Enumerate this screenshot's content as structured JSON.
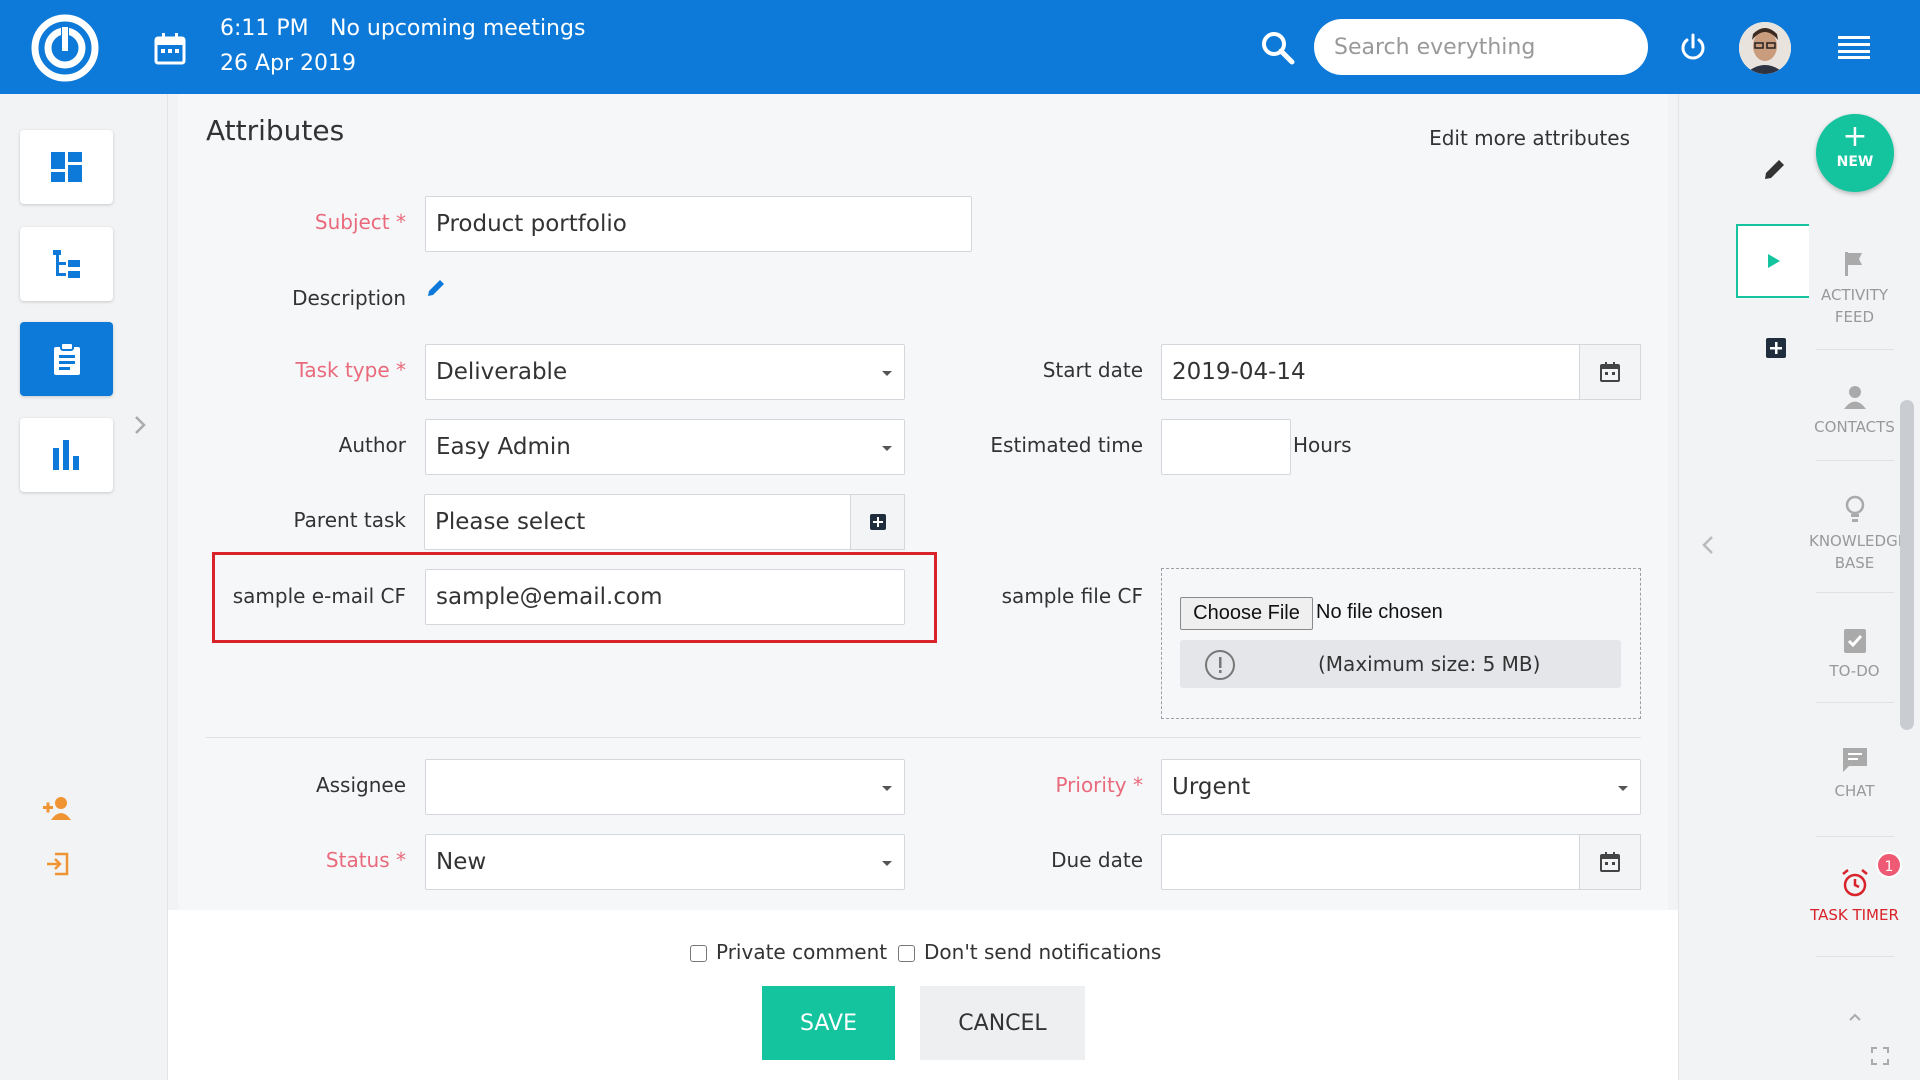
{
  "header": {
    "time": "6:11 PM",
    "meetings": "No upcoming meetings",
    "date": "26 Apr 2019",
    "search_placeholder": "Search everything"
  },
  "form": {
    "section_title": "Attributes",
    "edit_more": "Edit more attributes",
    "subject_label": "Subject *",
    "subject_value": "Product portfolio",
    "description_label": "Description",
    "task_type_label": "Task type *",
    "task_type_value": "Deliverable",
    "author_label": "Author",
    "author_value": "Easy Admin",
    "parent_task_label": "Parent task",
    "parent_task_value": "Please select",
    "email_cf_label": "sample e-mail CF",
    "email_cf_value": "sample@email.com",
    "start_date_label": "Start date",
    "start_date_value": "2019-04-14",
    "estimated_time_label": "Estimated time",
    "estimated_time_value": "",
    "hours_label": "Hours",
    "file_cf_label": "sample file CF",
    "choose_file": "Choose File",
    "no_file": "No file chosen",
    "max_size": "(Maximum size: 5 MB)",
    "assignee_label": "Assignee",
    "assignee_value": "",
    "priority_label": "Priority *",
    "priority_value": "Urgent",
    "status_label": "Status *",
    "status_value": "New",
    "due_date_label": "Due date",
    "due_date_value": ""
  },
  "footer": {
    "private_comment": "Private comment",
    "dont_send": "Don't send notifications",
    "save": "SAVE",
    "cancel": "CANCEL"
  },
  "sidebar": {
    "new": "NEW",
    "activity_feed": "ACTIVITY FEED",
    "contacts": "CONTACTS",
    "knowledge_base": "KNOWLEDGE BASE",
    "todo": "TO-DO",
    "chat": "CHAT",
    "task_timer": "TASK TIMER",
    "timer_badge": "1"
  },
  "colors": {
    "brand_blue": "#0d7ad9",
    "accent_green": "#13c49e",
    "required_red": "#e96a7b",
    "highlight_red": "#d9232a"
  }
}
